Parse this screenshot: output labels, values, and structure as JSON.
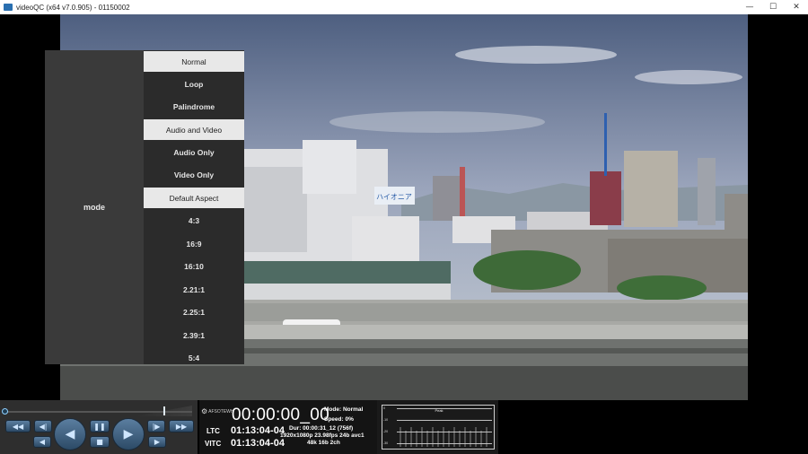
{
  "window": {
    "title": "videoQC (x64 v7.0.905) - 01150002",
    "minimize": "—",
    "maximize": "☐",
    "close": "✕"
  },
  "mode_menu": {
    "label": "mode",
    "options": [
      {
        "label": "Normal",
        "selected": true
      },
      {
        "label": "Loop",
        "selected": false
      },
      {
        "label": "Palindrome",
        "selected": false
      },
      {
        "label": "Audio and Video",
        "selected": true
      },
      {
        "label": "Audio Only",
        "selected": false
      },
      {
        "label": "Video Only",
        "selected": false
      },
      {
        "label": "Default Aspect",
        "selected": true
      },
      {
        "label": "4:3",
        "selected": false
      },
      {
        "label": "16:9",
        "selected": false
      },
      {
        "label": "16:10",
        "selected": false
      },
      {
        "label": "2.21:1",
        "selected": false
      },
      {
        "label": "2.25:1",
        "selected": false
      },
      {
        "label": "2.39:1",
        "selected": false
      },
      {
        "label": "5:4",
        "selected": false
      }
    ]
  },
  "transport": {
    "rewind_fast": "◀◀",
    "step_back": "◀|",
    "play_reverse": "◀",
    "pause": "❚❚",
    "stop": "■",
    "play": "▶",
    "step_forward": "|▶",
    "forward_fast": "▶▶",
    "frame_back": "◀",
    "frame_forward": "▶"
  },
  "timecode": {
    "logo_text": "AFSOTEWH",
    "current": "00:00:00_00",
    "ltc_label": "LTC",
    "ltc_value": "01:13:04-04",
    "vitc_label": "VITC",
    "vitc_value": "01:13:04-04",
    "mode": "Mode: Normal",
    "speed": "Speed: 0%",
    "duration": "Dur: 00:00:31_12 (756f)",
    "format": "1920x1080p 23.98fps 24b avc1",
    "audio": "48k 16b 2ch"
  },
  "audio_meter": {
    "title": "Peak",
    "scale": [
      "0",
      "-10",
      "-20",
      "-30"
    ]
  },
  "colors": {
    "titlebar_bg": "#ffffff",
    "panel_bg": "#3a3a3a",
    "list_bg": "#2b2b2b",
    "selected_bg": "#e8e8e8",
    "button_blue": "#3f6385"
  }
}
